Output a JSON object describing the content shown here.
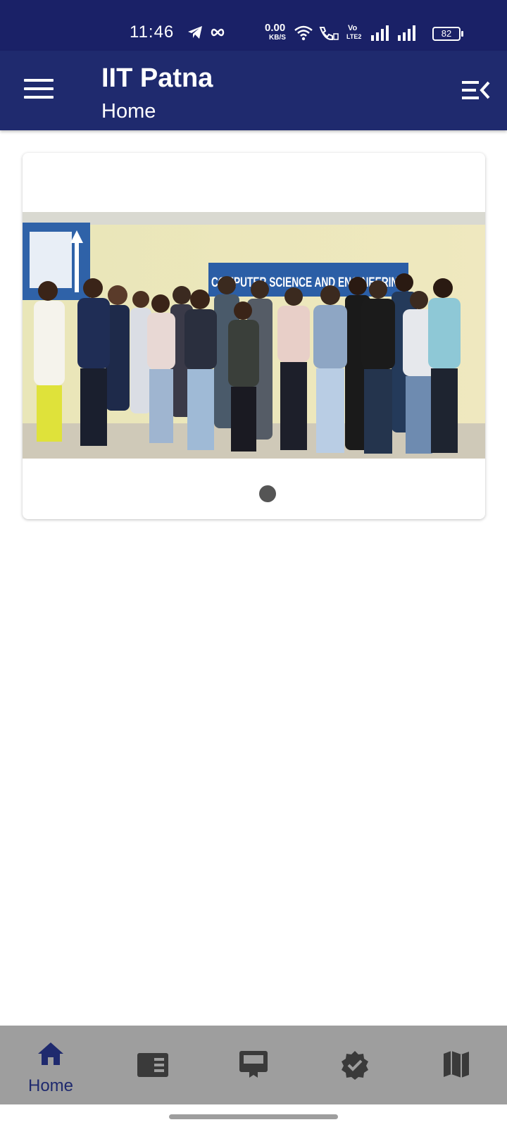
{
  "status": {
    "time": "11:46",
    "net_speed_value": "0.00",
    "net_speed_unit": "KB/S",
    "volte_top": "Vo",
    "volte_bottom": "LTE2",
    "battery": "82"
  },
  "app_bar": {
    "title": "IIT Patna",
    "subtitle": "Home"
  },
  "carousel": {
    "banner_text": "COMPUTER SCIENCE AND ENGINEERING",
    "slide_count": 1,
    "active_slide": 1
  },
  "bottom_nav": {
    "items": [
      {
        "label": "Home",
        "icon": "home-icon",
        "active": true
      },
      {
        "label": "",
        "icon": "news-icon",
        "active": false
      },
      {
        "label": "",
        "icon": "notice-board-icon",
        "active": false
      },
      {
        "label": "",
        "icon": "verified-badge-icon",
        "active": false
      },
      {
        "label": "",
        "icon": "map-icon",
        "active": false
      }
    ]
  },
  "colors": {
    "primary": "#1f2a6e",
    "status_bar": "#1a2167",
    "bottom_nav_bg": "#9e9e9e",
    "icon_inactive": "#3a3a3a"
  }
}
